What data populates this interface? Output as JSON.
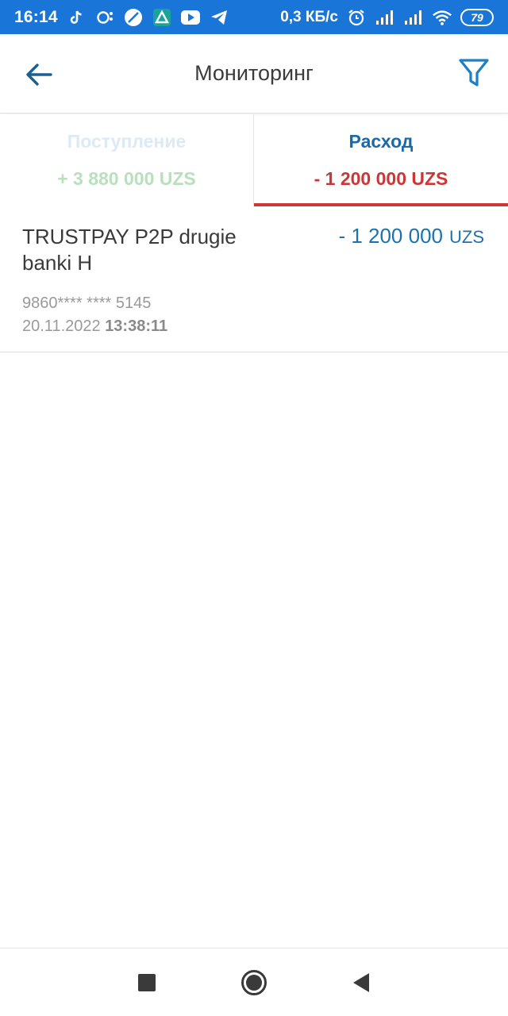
{
  "status_bar": {
    "time": "16:14",
    "net_speed": "0,3 КБ/с",
    "battery": "79",
    "icons": [
      "tiktok-icon",
      "chat-icon",
      "compass-icon",
      "app-icon",
      "youtube-icon",
      "telegram-icon",
      "alarm-icon",
      "signal-icon",
      "signal-icon",
      "wifi-icon"
    ]
  },
  "header": {
    "title": "Мониторинг",
    "back_icon": "arrow-left-icon",
    "filter_icon": "filter-icon"
  },
  "tabs": [
    {
      "label": "Поступление",
      "amount": "+ 3 880 000 UZS",
      "active": false
    },
    {
      "label": "Расход",
      "amount": "- 1 200 000 UZS",
      "active": true
    }
  ],
  "transactions": [
    {
      "description": "TRUSTPAY P2P drugie banki H",
      "amount": "- 1 200 000",
      "currency": "UZS",
      "card": "9860**** **** 5145",
      "date": "20.11.2022",
      "time": "13:38:11"
    }
  ],
  "colors": {
    "status_bar": "#1976d8",
    "accent_blue": "#1b72ad",
    "expense_red": "#cc3636",
    "income_green": "#b8e0bd"
  },
  "nav_bar": {
    "icons": [
      "recents-icon",
      "home-icon",
      "back-icon"
    ]
  }
}
